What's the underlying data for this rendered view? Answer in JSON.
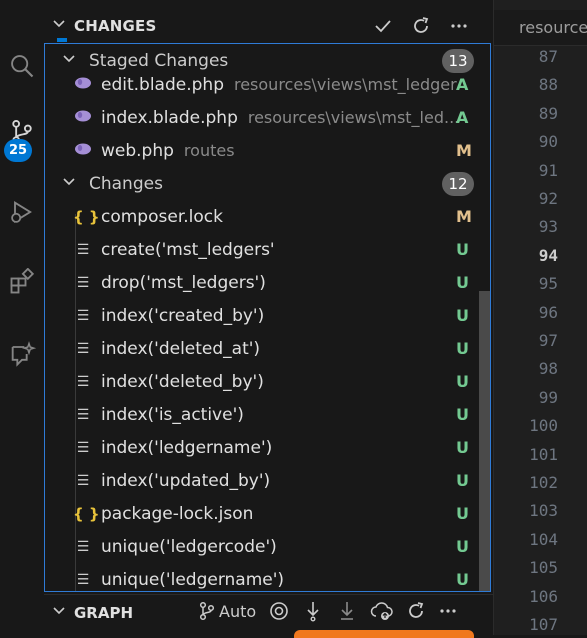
{
  "activity_bar": {
    "scm_badge": "25"
  },
  "panel": {
    "title": "CHANGES",
    "staged": {
      "label": "Staged Changes",
      "count": "13",
      "files": [
        {
          "name": "edit.blade.php",
          "path": "resources\\views\\mst_ledger",
          "status": "A",
          "icon": "php-elephant-icon"
        },
        {
          "name": "index.blade.php",
          "path": "resources\\views\\mst_led...",
          "status": "A",
          "icon": "php-elephant-icon"
        },
        {
          "name": "web.php",
          "path": "routes",
          "status": "M",
          "icon": "php-elephant-icon"
        }
      ]
    },
    "changes": {
      "label": "Changes",
      "count": "12",
      "files": [
        {
          "name": "composer.lock",
          "status": "M",
          "icon": "json-braces-icon"
        },
        {
          "name": "create('mst_ledgers'",
          "status": "U",
          "icon": "text-lines-icon"
        },
        {
          "name": "drop('mst_ledgers')",
          "status": "U",
          "icon": "text-lines-icon"
        },
        {
          "name": "index('created_by')",
          "status": "U",
          "icon": "text-lines-icon"
        },
        {
          "name": "index('deleted_at')",
          "status": "U",
          "icon": "text-lines-icon"
        },
        {
          "name": "index('deleted_by')",
          "status": "U",
          "icon": "text-lines-icon"
        },
        {
          "name": "index('is_active')",
          "status": "U",
          "icon": "text-lines-icon"
        },
        {
          "name": "index('ledgername')",
          "status": "U",
          "icon": "text-lines-icon"
        },
        {
          "name": "index('updated_by')",
          "status": "U",
          "icon": "text-lines-icon"
        },
        {
          "name": "package-lock.json",
          "status": "U",
          "icon": "json-braces-icon"
        },
        {
          "name": "unique('ledgercode')",
          "status": "U",
          "icon": "text-lines-icon"
        },
        {
          "name": "unique('ledgername')",
          "status": "U",
          "icon": "text-lines-icon"
        }
      ]
    },
    "graph": {
      "title": "GRAPH",
      "auto_label": "Auto"
    }
  },
  "editor": {
    "tab_label": "resources",
    "line_numbers": [
      "87",
      "88",
      "89",
      "90",
      "91",
      "92",
      "93",
      "94",
      "95",
      "96",
      "97",
      "98",
      "99",
      "100",
      "101",
      "102",
      "103",
      "104",
      "105",
      "106",
      "107"
    ],
    "current_line": "94"
  },
  "colors": {
    "accent": "#0078d4",
    "added": "#73c991",
    "modified": "#e2c08d",
    "focus_border": "#2f7bd6"
  }
}
